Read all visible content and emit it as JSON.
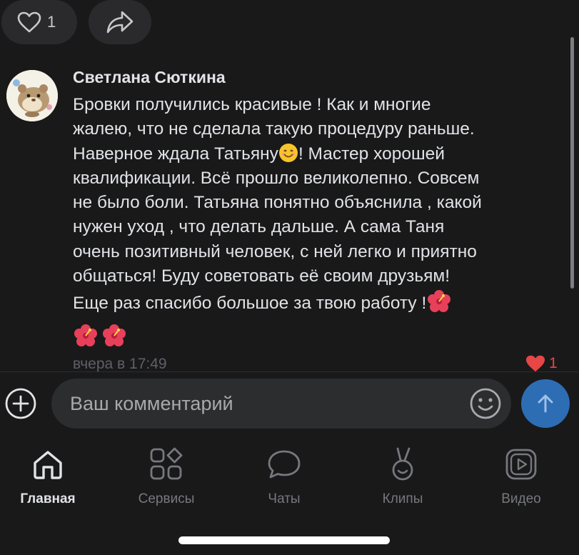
{
  "post_actions": {
    "like_count": "1"
  },
  "comment": {
    "author": "Светлана Сюткина",
    "text_part1": "Бровки получились красивые ! Как и многие\nжалею, что не сделала такую процедуру раньше.\nНаверное ждала Татьяну",
    "text_part2": "! Мастер хорошей\nквалификации. Всё прошло великолепно. Совсем\nне было боли. Татьяна понятно объяснила , какой\nнужен уход  , что делать дальше. А сама Таня\nочень позитивный человек, с ней легко и приятно\nобщаться! Буду советовать её своим друзьям!\nЕще раз  спасибо  большое  за  твою работу !",
    "time": "вчера в 17:49",
    "like_count": "1"
  },
  "composer": {
    "placeholder": "Ваш комментарий"
  },
  "tabs": [
    {
      "label": "Главная",
      "icon": "home-icon",
      "active": true
    },
    {
      "label": "Сервисы",
      "icon": "services-icon",
      "active": false
    },
    {
      "label": "Чаты",
      "icon": "chat-icon",
      "active": false
    },
    {
      "label": "Клипы",
      "icon": "clips-icon",
      "active": false
    },
    {
      "label": "Видео",
      "icon": "video-icon",
      "active": false
    }
  ],
  "colors": {
    "background": "#19191a",
    "accent": "#2d6db4",
    "like_red": "#e64646",
    "muted": "#76787d"
  }
}
